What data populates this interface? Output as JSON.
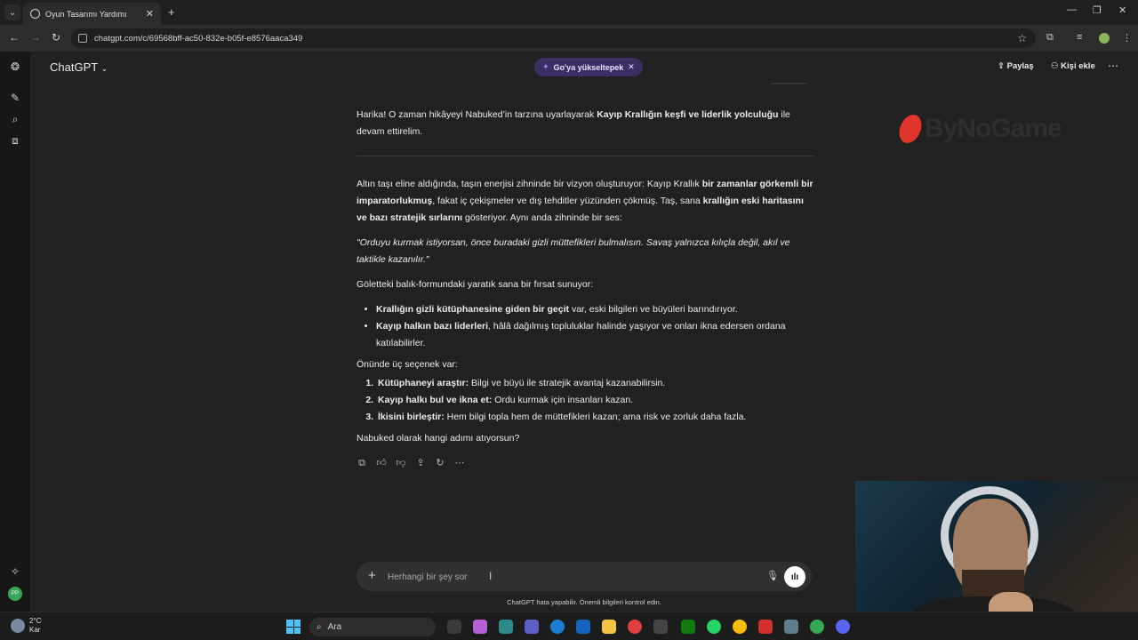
{
  "browser": {
    "tab_title": "Oyun Tasarımı Yardımı",
    "url": "chatgpt.com/c/69568bff-ac50-832e-b05f-e8576aaca349"
  },
  "header": {
    "model_label": "ChatGPT",
    "upgrade_pill": "Go'ya yükseltерek",
    "share_label": "Paylaş",
    "add_person_label": "Kişi ekle"
  },
  "message": {
    "intro_plain_1": "Harika! O zaman hikâyeyi Nabuked’in tarzına uyarlayarak ",
    "intro_bold": "Kayıp Krallığın keşfi ve liderlik yolculuğu",
    "intro_plain_2": " ile devam ettirelim.",
    "p1_a": "Altın taşı eline aldığında, taşın enerjisi zihninde bir vizyon oluşturuyor: Kayıp Krallık ",
    "p1_b": "bir zamanlar görkemli bir imparatorlukmuş",
    "p1_c": ", fakat iç çekişmeler ve dış tehditler yüzünden çökmüş. Taş, sana ",
    "p1_d": "krallığın eski haritasını ve bazı stratejik sırlarını",
    "p1_e": " gösteriyor. Aynı anda zihninde bir ses:",
    "quote": "\"Orduyu kurmak istiyorsan, önce buradaki gizli müttefikleri bulmalısın. Savaş yalnızca kılıçla değil, akıl ve taktikle kazanılır.\"",
    "p2": "Göletteki balık-formundaki yaratık sana bir fırsat sunuyor:",
    "bullets": [
      {
        "bold": "Krallığın gizli kütüphanesine giden bir geçit",
        "text": " var, eski bilgileri ve büyüleri barındırıyor."
      },
      {
        "bold": "Kayıp halkın bazı liderleri",
        "text": ", hâlâ dağılmış topluluklar halinde yaşıyor ve onları ikna edersen ordana katılabilirler."
      }
    ],
    "options_intro": "Önünde üç seçenek var:",
    "options": [
      {
        "bold": "Kütüphaneyi araştır:",
        "text": " Bilgi ve büyü ile stratejik avantaj kazanabilirsin."
      },
      {
        "bold": "Kayıp halkı bul ve ikna et:",
        "text": " Ordu kurmak için insanları kazan."
      },
      {
        "bold": "İkisini birleştir:",
        "text": " Hem bilgi topla hem de müttefikleri kazan; ama risk ve zorluk daha fazla."
      }
    ],
    "closing": "Nabuked olarak hangi adımı atıyorsun?"
  },
  "watermark": {
    "text": "ByNoGame"
  },
  "composer": {
    "placeholder": "Herhangi bir şey sor",
    "disclaimer": "ChatGPT hata yapabilir. Önemli bilgileri kontrol edin."
  },
  "taskbar": {
    "temperature": "2°C",
    "weather_label": "Kar",
    "search_label": "Ara"
  }
}
